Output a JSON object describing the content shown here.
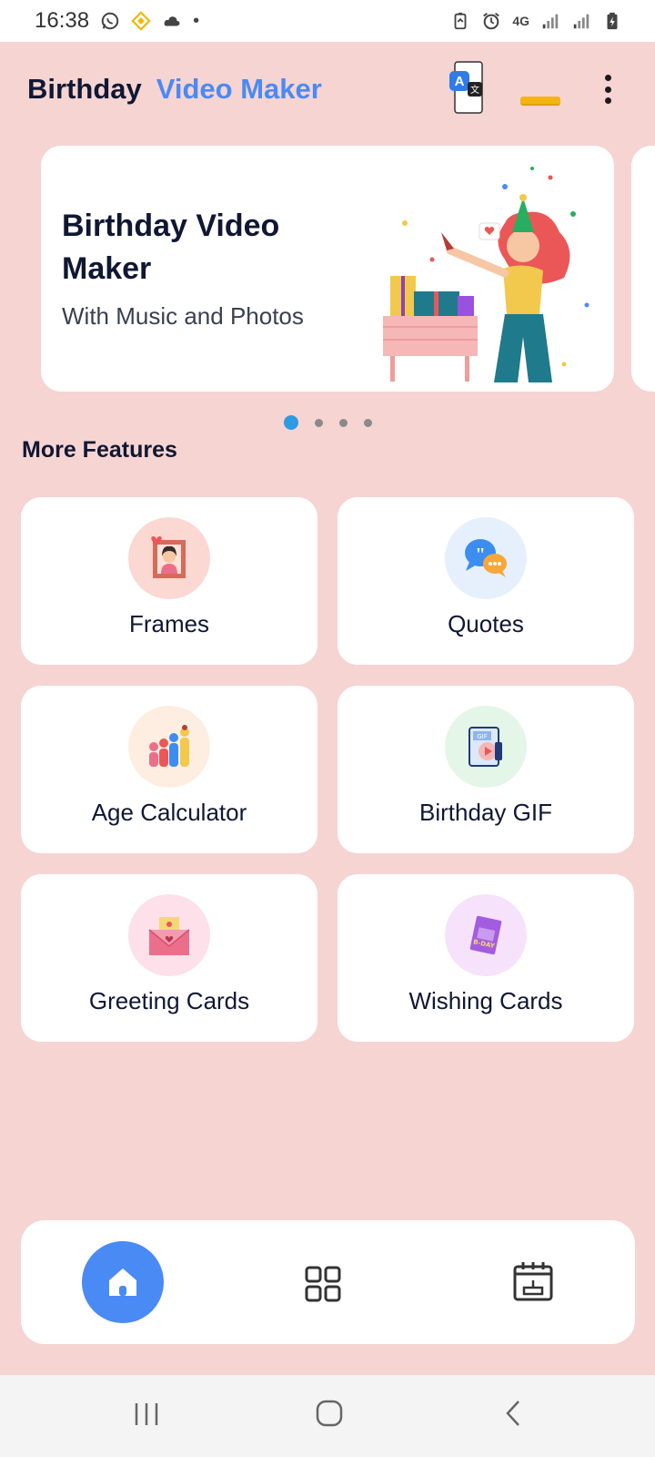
{
  "status_bar": {
    "time": "16:38",
    "network": "4G"
  },
  "app_bar": {
    "title_part1": "Birthday",
    "title_part2": "Video Maker",
    "translate_icon_letter_a": "A",
    "translate_icon_letter_b": "文",
    "accent_color": "#4a8af4"
  },
  "banner": {
    "title": "Birthday Video Maker",
    "subtitle": "With Music and Photos",
    "slide_count": 4,
    "active_slide": 1
  },
  "section": {
    "title": "More Features"
  },
  "features": [
    {
      "label": "Frames",
      "icon": "photo-frame-icon",
      "circle_color": "#fbd8d2"
    },
    {
      "label": "Quotes",
      "icon": "chat-bubbles-icon",
      "circle_color": "#e6f0fd"
    },
    {
      "label": "Age Calculator",
      "icon": "family-height-icon",
      "circle_color": "#fdeee1"
    },
    {
      "label": "Birthday GIF",
      "icon": "gif-video-icon",
      "circle_color": "#e4f6e7"
    },
    {
      "label": "Greeting Cards",
      "icon": "envelope-icon",
      "circle_color": "#fde0ea"
    },
    {
      "label": "Wishing Cards",
      "icon": "bday-card-icon",
      "circle_color": "#f6e2fb"
    }
  ],
  "bottom_nav": {
    "items": [
      "home-icon",
      "grid-icon",
      "calendar-cake-icon"
    ],
    "active": "home-icon",
    "active_color": "#4a8af4"
  },
  "system_nav": {
    "items": [
      "recent-apps-icon",
      "home-button-icon",
      "back-icon"
    ]
  }
}
